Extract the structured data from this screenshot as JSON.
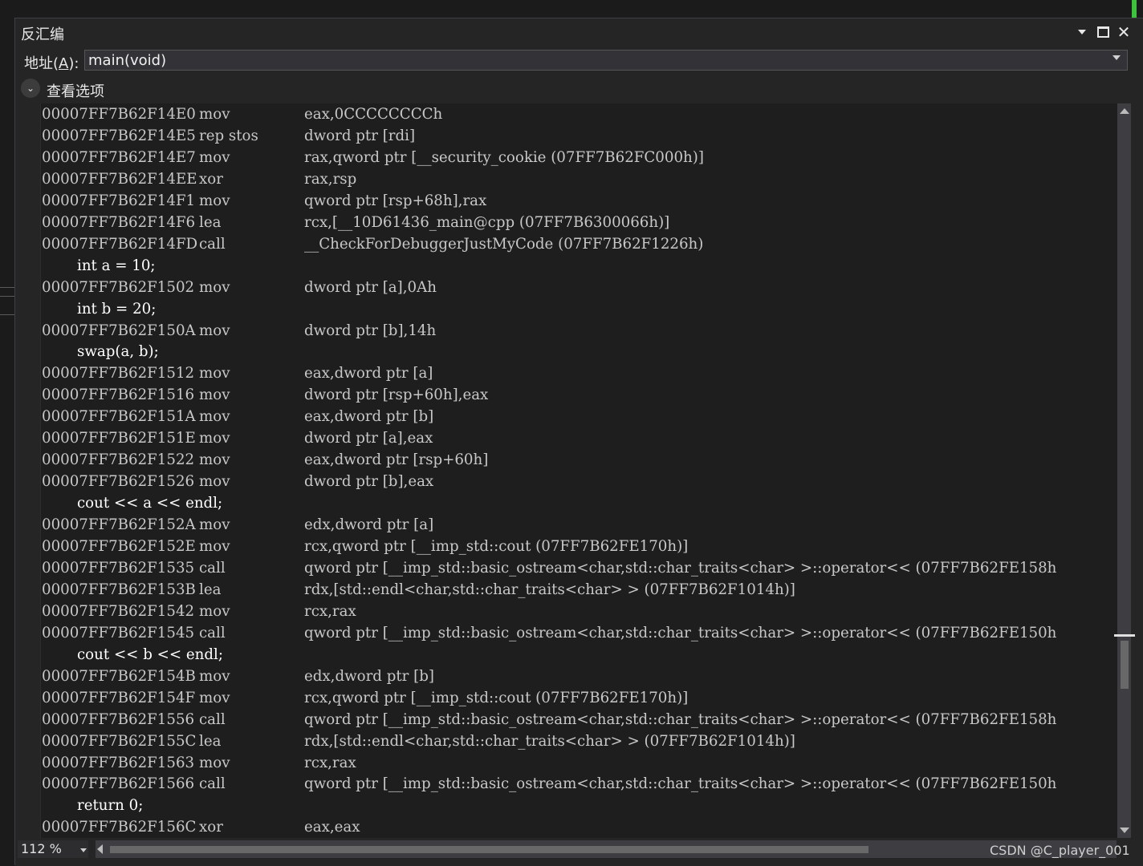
{
  "window": {
    "title": "反汇编"
  },
  "address_bar": {
    "label_prefix": "地址(",
    "label_accesskey": "A",
    "label_suffix": "):",
    "value": "main(void)"
  },
  "view_options": {
    "label": "查看选项"
  },
  "disassembly": [
    {
      "type": "asm",
      "addr": "00007FF7B62F14E0",
      "mnemonic": "mov",
      "operands": "eax,0CCCCCCCCh"
    },
    {
      "type": "asm",
      "addr": "00007FF7B62F14E5",
      "mnemonic": "rep stos",
      "operands": "dword ptr [rdi]"
    },
    {
      "type": "asm",
      "addr": "00007FF7B62F14E7",
      "mnemonic": "mov",
      "operands": "rax,qword ptr [__security_cookie (07FF7B62FC000h)]"
    },
    {
      "type": "asm",
      "addr": "00007FF7B62F14EE",
      "mnemonic": "xor",
      "operands": "rax,rsp"
    },
    {
      "type": "asm",
      "addr": "00007FF7B62F14F1",
      "mnemonic": "mov",
      "operands": "qword ptr [rsp+68h],rax"
    },
    {
      "type": "asm",
      "addr": "00007FF7B62F14F6",
      "mnemonic": "lea",
      "operands": "rcx,[__10D61436_main@cpp (07FF7B6300066h)]"
    },
    {
      "type": "asm",
      "addr": "00007FF7B62F14FD",
      "mnemonic": "call",
      "operands": "__CheckForDebuggerJustMyCode (07FF7B62F1226h)"
    },
    {
      "type": "src",
      "text": "int a = 10;"
    },
    {
      "type": "asm",
      "addr": "00007FF7B62F1502",
      "mnemonic": "mov",
      "operands": "dword ptr [a],0Ah"
    },
    {
      "type": "src",
      "text": "int b = 20;"
    },
    {
      "type": "asm",
      "addr": "00007FF7B62F150A",
      "mnemonic": "mov",
      "operands": "dword ptr [b],14h"
    },
    {
      "type": "src",
      "text": "swap(a, b);"
    },
    {
      "type": "asm",
      "addr": "00007FF7B62F1512",
      "mnemonic": "mov",
      "operands": "eax,dword ptr [a]"
    },
    {
      "type": "asm",
      "addr": "00007FF7B62F1516",
      "mnemonic": "mov",
      "operands": "dword ptr [rsp+60h],eax"
    },
    {
      "type": "asm",
      "addr": "00007FF7B62F151A",
      "mnemonic": "mov",
      "operands": "eax,dword ptr [b]"
    },
    {
      "type": "asm",
      "addr": "00007FF7B62F151E",
      "mnemonic": "mov",
      "operands": "dword ptr [a],eax"
    },
    {
      "type": "asm",
      "addr": "00007FF7B62F1522",
      "mnemonic": "mov",
      "operands": "eax,dword ptr [rsp+60h]"
    },
    {
      "type": "asm",
      "addr": "00007FF7B62F1526",
      "mnemonic": "mov",
      "operands": "dword ptr [b],eax"
    },
    {
      "type": "src",
      "text": "cout << a << endl;"
    },
    {
      "type": "asm",
      "addr": "00007FF7B62F152A",
      "mnemonic": "mov",
      "operands": "edx,dword ptr [a]"
    },
    {
      "type": "asm",
      "addr": "00007FF7B62F152E",
      "mnemonic": "mov",
      "operands": "rcx,qword ptr [__imp_std::cout (07FF7B62FE170h)]"
    },
    {
      "type": "asm",
      "addr": "00007FF7B62F1535",
      "mnemonic": "call",
      "operands": "qword ptr [__imp_std::basic_ostream<char,std::char_traits<char> >::operator<< (07FF7B62FE158h"
    },
    {
      "type": "asm",
      "addr": "00007FF7B62F153B",
      "mnemonic": "lea",
      "operands": "rdx,[std::endl<char,std::char_traits<char> > (07FF7B62F1014h)]"
    },
    {
      "type": "asm",
      "addr": "00007FF7B62F1542",
      "mnemonic": "mov",
      "operands": "rcx,rax"
    },
    {
      "type": "asm",
      "addr": "00007FF7B62F1545",
      "mnemonic": "call",
      "operands": "qword ptr [__imp_std::basic_ostream<char,std::char_traits<char> >::operator<< (07FF7B62FE150h"
    },
    {
      "type": "src",
      "text": "cout << b << endl;"
    },
    {
      "type": "asm",
      "addr": "00007FF7B62F154B",
      "mnemonic": "mov",
      "operands": "edx,dword ptr [b]"
    },
    {
      "type": "asm",
      "addr": "00007FF7B62F154F",
      "mnemonic": "mov",
      "operands": "rcx,qword ptr [__imp_std::cout (07FF7B62FE170h)]"
    },
    {
      "type": "asm",
      "addr": "00007FF7B62F1556",
      "mnemonic": "call",
      "operands": "qword ptr [__imp_std::basic_ostream<char,std::char_traits<char> >::operator<< (07FF7B62FE158h"
    },
    {
      "type": "asm",
      "addr": "00007FF7B62F155C",
      "mnemonic": "lea",
      "operands": "rdx,[std::endl<char,std::char_traits<char> > (07FF7B62F1014h)]"
    },
    {
      "type": "asm",
      "addr": "00007FF7B62F1563",
      "mnemonic": "mov",
      "operands": "rcx,rax"
    },
    {
      "type": "asm",
      "addr": "00007FF7B62F1566",
      "mnemonic": "call",
      "operands": "qword ptr [__imp_std::basic_ostream<char,std::char_traits<char> >::operator<< (07FF7B62FE150h"
    },
    {
      "type": "src",
      "text": "return 0;"
    },
    {
      "type": "asm",
      "addr": "00007FF7B62F156C",
      "mnemonic": "xor",
      "operands": "eax,eax"
    }
  ],
  "status": {
    "zoom": "112 %",
    "watermark": "CSDN @C_player_001"
  },
  "colors": {
    "background": "#1e1e1e",
    "panel": "#252526",
    "accent": "#3ec33e"
  }
}
